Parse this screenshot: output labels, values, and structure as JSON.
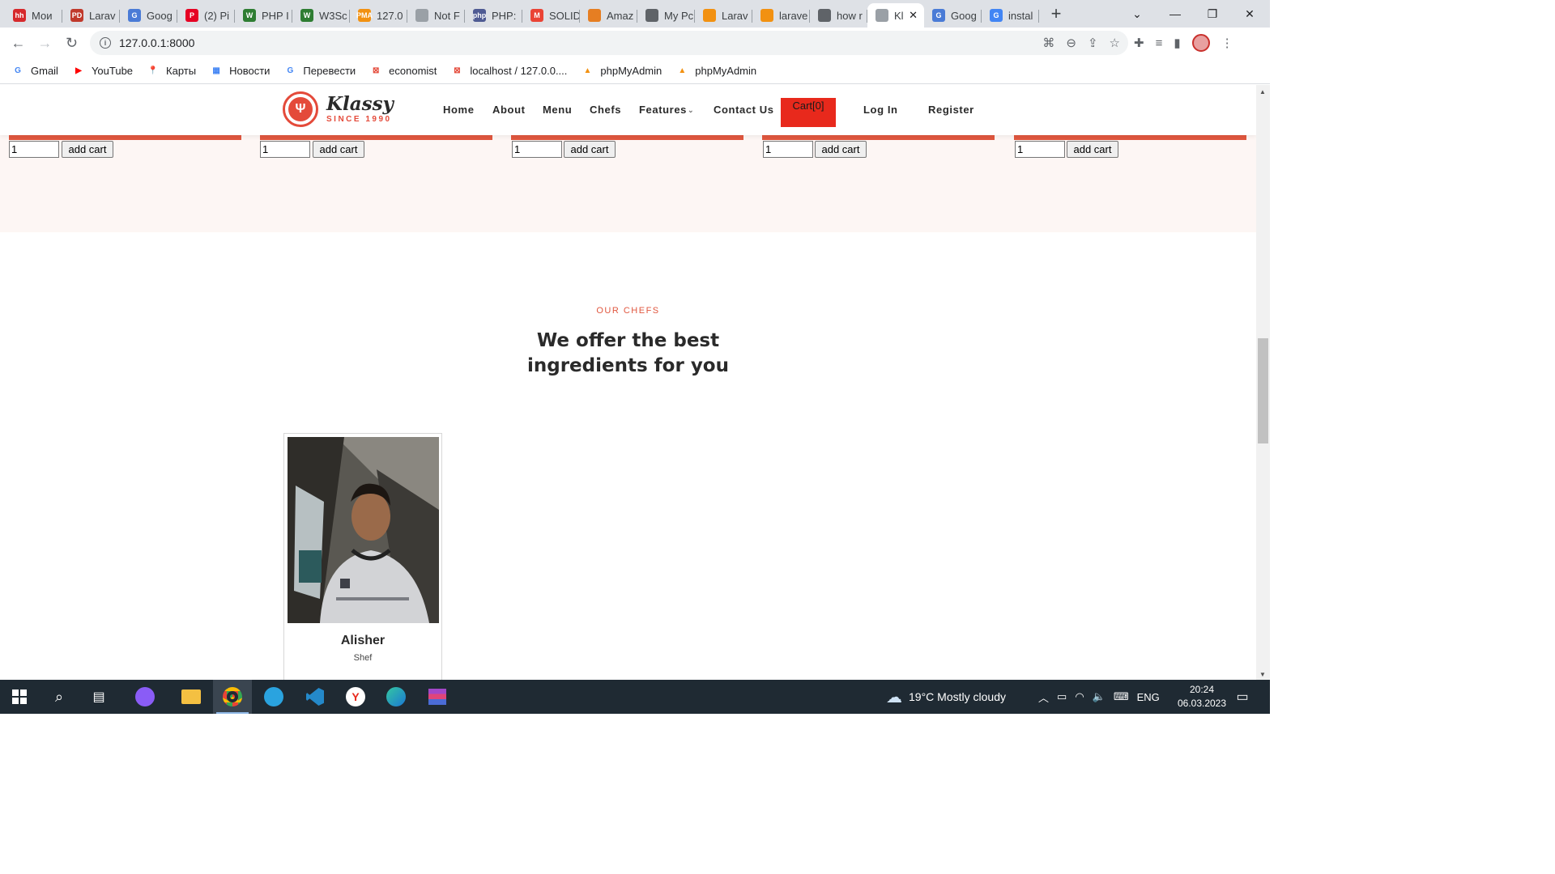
{
  "browser": {
    "tabs": [
      {
        "title": "Мои",
        "fav_color": "#d6292c",
        "fav_text": "hh"
      },
      {
        "title": "Larav",
        "fav_color": "#c0392b",
        "fav_text": "PD"
      },
      {
        "title": "Goog",
        "fav_color": "#4a7bd6",
        "fav_text": "G"
      },
      {
        "title": "(2) Pi",
        "fav_color": "#e60023",
        "fav_text": "P"
      },
      {
        "title": "PHP I",
        "fav_color": "#2e7d32",
        "fav_text": "W"
      },
      {
        "title": "W3Sc",
        "fav_color": "#2e7d32",
        "fav_text": "W"
      },
      {
        "title": "127.0",
        "fav_color": "#f29111",
        "fav_text": "PMA"
      },
      {
        "title": "Not F",
        "fav_color": "#9aa0a6",
        "fav_text": ""
      },
      {
        "title": "PHP:",
        "fav_color": "#4f5b93",
        "fav_text": "php"
      },
      {
        "title": "SOLID",
        "fav_color": "#ea4335",
        "fav_text": "M"
      },
      {
        "title": "Amaz",
        "fav_color": "#e67e22",
        "fav_text": ""
      },
      {
        "title": "My Pc",
        "fav_color": "#5f6368",
        "fav_text": ""
      },
      {
        "title": "Larav",
        "fav_color": "#f29111",
        "fav_text": ""
      },
      {
        "title": "larave",
        "fav_color": "#f29111",
        "fav_text": ""
      },
      {
        "title": "how r",
        "fav_color": "#5f6368",
        "fav_text": ""
      },
      {
        "title": "Kl",
        "fav_color": "#9aa0a6",
        "fav_text": "",
        "active": true
      },
      {
        "title": "Goog",
        "fav_color": "#4a7bd6",
        "fav_text": "G"
      },
      {
        "title": "instal",
        "fav_color": "#4285f4",
        "fav_text": "G"
      }
    ],
    "url": "127.0.0.1:8000",
    "bookmarks": [
      {
        "label": "Gmail",
        "icon": "G",
        "color": "#4285f4"
      },
      {
        "label": "YouTube",
        "icon": "▶",
        "color": "#ff0000"
      },
      {
        "label": "Карты",
        "icon": "📍",
        "color": "#34a853"
      },
      {
        "label": "Новости",
        "icon": "▦",
        "color": "#4285f4"
      },
      {
        "label": "Перевести",
        "icon": "G",
        "color": "#4285f4"
      },
      {
        "label": "economist",
        "icon": "⊠",
        "color": "#e44a3a"
      },
      {
        "label": "localhost / 127.0.0....",
        "icon": "⊠",
        "color": "#e44a3a"
      },
      {
        "label": "phpMyAdmin",
        "icon": "▲",
        "color": "#f29111"
      },
      {
        "label": "phpMyAdmin",
        "icon": "▲",
        "color": "#f29111"
      }
    ]
  },
  "site": {
    "logo": {
      "name": "Klassy",
      "tagline": "SINCE 1990"
    },
    "nav": {
      "home": "Home",
      "about": "About",
      "menu": "Menu",
      "chefs": "Chefs",
      "features": "Features",
      "contact": "Contact Us",
      "cart": "Cart[0]",
      "login": "Log In",
      "register": "Register"
    },
    "menu_items": [
      {
        "qty": "1",
        "button": "add cart"
      },
      {
        "qty": "1",
        "button": "add cart"
      },
      {
        "qty": "1",
        "button": "add cart"
      },
      {
        "qty": "1",
        "button": "add cart"
      },
      {
        "qty": "1",
        "button": "add cart"
      }
    ],
    "chefs_section": {
      "label": "OUR CHEFS",
      "title_line1": "We offer the best",
      "title_line2": "ingredients for you",
      "chefs": [
        {
          "name": "Alisher",
          "role": "Shef"
        }
      ]
    }
  },
  "taskbar": {
    "weather": "19°C  Mostly cloudy",
    "language": "ENG",
    "time": "20:24",
    "date": "06.03.2023"
  },
  "colors": {
    "accent": "#e0573f",
    "cart_bg": "#e8291c",
    "menu_band": "#fdf6f4"
  }
}
